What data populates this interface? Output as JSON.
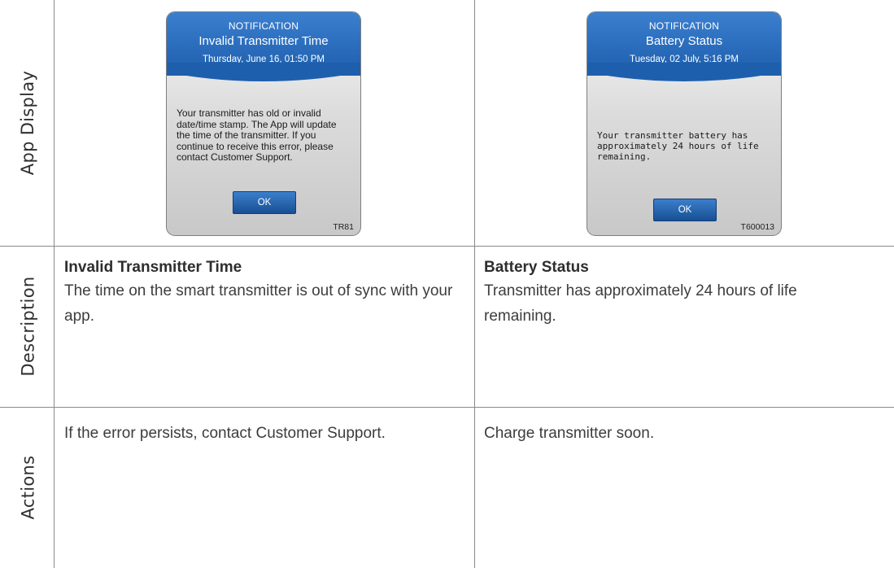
{
  "rows": {
    "app_display": "App Display",
    "description": "Description",
    "actions": "Actions"
  },
  "columns": [
    {
      "notification": {
        "kicker": "NOTIFICATION",
        "title": "Invalid Transmitter Time",
        "date": "Thursday, June 16, 01:50 PM",
        "message": "Your transmitter has old or invalid date/time stamp. The App will update the time of the transmitter. If you continue to receive this error, please contact Customer Support.",
        "button": "OK",
        "code": "TR81"
      },
      "description_title": "Invalid Transmitter Time",
      "description_body": "The time on the smart transmitter is out of sync with your app.",
      "action": "If the error persists, contact Customer Support."
    },
    {
      "notification": {
        "kicker": "NOTIFICATION",
        "title": "Battery Status",
        "date": "Tuesday, 02 July, 5:16 PM",
        "message": "Your transmitter battery has approximately 24 hours of life remaining.",
        "button": "OK",
        "code": "T600013"
      },
      "description_title": "Battery Status",
      "description_body": "Transmitter has approximately 24 hours of life remaining.",
      "action": "Charge transmitter soon."
    }
  ],
  "colors": {
    "header_blue": "#2a6fbf",
    "button_blue": "#2563ad",
    "rule_gray": "#8a8a8a"
  }
}
